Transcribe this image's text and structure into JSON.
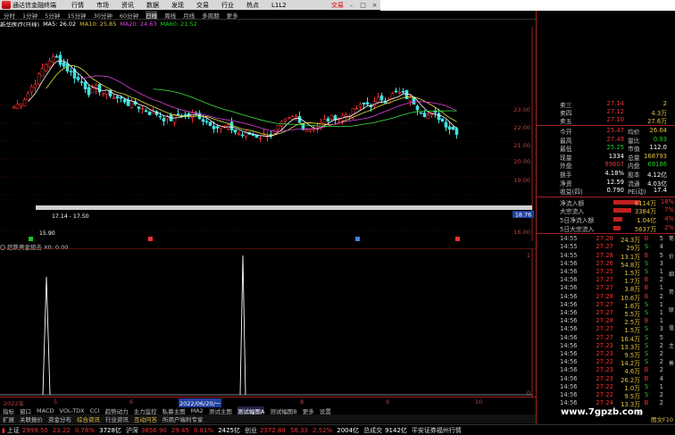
{
  "titlebar": {
    "app_name": "通达信金融终端",
    "menus": [
      "行情",
      "市场",
      "资讯",
      "数据",
      "发现",
      "交易",
      "行业",
      "热点",
      "L1L2"
    ],
    "trade_label": "交易"
  },
  "periods": [
    "分时",
    "1分钟",
    "5分钟",
    "15分钟",
    "30分钟",
    "60分钟",
    "日线",
    "周线",
    "月线",
    "多周期",
    "更多"
  ],
  "active_period": "日线",
  "ma_line": {
    "stock": "新华医疗(日线)",
    "ma5": "MA5: 26.02",
    "ma10": "MA10: 25.85",
    "ma20": "MA20: 24.63",
    "ma60": "MA60: 21.52"
  },
  "colors": {
    "up": "#f03030",
    "down": "#40e0e0",
    "ma5": "#ffffff",
    "ma10": "#e0e040",
    "ma20": "#e040e0",
    "ma60": "#40e040"
  },
  "main_chart": {
    "price_ticks": [
      "23.00",
      "22.00",
      "21.00",
      "20.00",
      "19.00",
      "17.00",
      "16.00"
    ],
    "current_price_tag": "18.76",
    "low_label": "15.90",
    "range_label": "17.14 - 17.50"
  },
  "sub_chart": {
    "title": "超跌黄金狙击 X0: 0.00",
    "ticks": [
      "1",
      "0"
    ]
  },
  "date_axis": {
    "labels": [
      "2022年",
      "5",
      "6",
      "2022/06/20/一",
      "8",
      "9",
      "10"
    ]
  },
  "indicator_tabs": [
    "指标",
    "窗口",
    "MACD",
    "VOL-TDX",
    "CCI",
    "趋势动力",
    "主力监控",
    "私募主图",
    "MA2",
    "测试主图",
    "测试幅图A",
    "测试幅图B",
    "更多",
    "设置"
  ],
  "active_indicator": "测试幅图A",
  "ext_tabs": [
    "扩展",
    "关联报价",
    "资金分布",
    "综合资讯",
    "行业资讯",
    "互动问答",
    "所用户端利专家"
  ],
  "status": {
    "sh_label": "上证",
    "sh_value": "2999.50",
    "sh_chg": "23.22",
    "sh_pct": "0.78%",
    "sh_amount": "3728亿",
    "sz_label": "沪深",
    "sz_value": "3656.90",
    "sz_chg": "29.45",
    "sz_pct": "0.81%",
    "sz_amount": "2425亿",
    "cy_label": "创业",
    "cy_value": "2372.88",
    "cy_chg": "58.33",
    "cy_pct": "2.52%",
    "cy_amount": "2004亿",
    "total_label": "总成交",
    "total_value": "9142亿",
    "broker": "平安证券福州行情"
  },
  "quote": {
    "sells": [
      {
        "label": "卖三",
        "price": "27.14",
        "vol": "2"
      },
      {
        "label": "卖四",
        "price": "27.12",
        "vol": "4.3万"
      },
      {
        "label": "卖五",
        "price": "27.10",
        "vol": "27.6万"
      }
    ],
    "rows": [
      {
        "k": "今开",
        "v": "25.47",
        "k2": "均价",
        "v2": "26.64"
      },
      {
        "k": "最高",
        "v": "27.49",
        "k2": "量比",
        "v2": "0.93"
      },
      {
        "k": "最低",
        "v": "25.25",
        "k2": "市值",
        "v2": "112.0"
      },
      {
        "k": "现量",
        "v": "1334",
        "k2": "总量",
        "v2": "168793"
      },
      {
        "k": "外盘",
        "v": "99607",
        "k2": "内盘",
        "v2": "69186"
      },
      {
        "k": "换手",
        "v": "4.18%",
        "k2": "股本",
        "v2": "4.12亿"
      },
      {
        "k": "净资",
        "v": "12.59",
        "k2": "流通",
        "v2": "4.03亿"
      },
      {
        "k": "收益(四)",
        "v": "0.790",
        "k2": "PE(动)",
        "v2": "17.4"
      }
    ],
    "flows": [
      {
        "k": "净流入额",
        "v": "6114万",
        "p": "18%"
      },
      {
        "k": "大宗流入",
        "v": "3384万",
        "p": "7%"
      },
      {
        "k": "5日净流入额",
        "v": "1.04亿",
        "p": "4%"
      },
      {
        "k": "5日大宗流入",
        "v": "5637万",
        "p": "2%"
      }
    ],
    "ticks": [
      {
        "t": "14:55",
        "p": "27.28",
        "q": "24.3万",
        "s": "B",
        "n": "5"
      },
      {
        "t": "14:55",
        "p": "27.27",
        "q": "29万",
        "s": "S",
        "n": "4"
      },
      {
        "t": "14:55",
        "p": "27.28",
        "q": "13.1万",
        "s": "B",
        "n": "5"
      },
      {
        "t": "14:56",
        "p": "27.26",
        "q": "54.8万",
        "s": "S",
        "n": "3"
      },
      {
        "t": "14:56",
        "p": "27.25",
        "q": "1.5万",
        "s": "S",
        "n": "1"
      },
      {
        "t": "14:56",
        "p": "27.27",
        "q": "1.7万",
        "s": "B",
        "n": "2"
      },
      {
        "t": "14:56",
        "p": "27.27",
        "q": "3.8万",
        "s": "B",
        "n": "1"
      },
      {
        "t": "14:56",
        "p": "27.28",
        "q": "10.6万",
        "s": "B",
        "n": "2"
      },
      {
        "t": "14:56",
        "p": "27.27",
        "q": "1.6万",
        "s": "S",
        "n": "1"
      },
      {
        "t": "14:56",
        "p": "27.27",
        "q": "5.5万",
        "s": "S",
        "n": "1"
      },
      {
        "t": "14:56",
        "p": "27.28",
        "q": "2.5万",
        "s": "B",
        "n": "1"
      },
      {
        "t": "14:56",
        "p": "27.27",
        "q": "1.5万",
        "s": "S",
        "n": "3"
      },
      {
        "t": "14:56",
        "p": "27.27",
        "q": "16.4万",
        "s": "S",
        "n": "5"
      },
      {
        "t": "14:56",
        "p": "27.23",
        "q": "13.3万",
        "s": "S",
        "n": "2"
      },
      {
        "t": "14:56",
        "p": "27.23",
        "q": "9.5万",
        "s": "S",
        "n": "2"
      },
      {
        "t": "14:56",
        "p": "27.22",
        "q": "14.2万",
        "s": "S",
        "n": "2"
      },
      {
        "t": "14:56",
        "p": "27.23",
        "q": "4.6万",
        "s": "B",
        "n": "2"
      },
      {
        "t": "14:56",
        "p": "27.23",
        "q": "26.2万",
        "s": "B",
        "n": "4"
      },
      {
        "t": "14:56",
        "p": "27.22",
        "q": "1.0万",
        "s": "S",
        "n": "1"
      },
      {
        "t": "14:56",
        "p": "27.22",
        "q": "9.5万",
        "s": "S",
        "n": "2"
      },
      {
        "t": "14:56",
        "p": "27.24",
        "q": "13.3万",
        "s": "B",
        "n": "2"
      }
    ],
    "bottom_label": "细",
    "bottom_label2": "图文F10",
    "side_buttons": [
      "笔",
      "价",
      "细",
      "势",
      "联",
      "值",
      "主",
      "筹"
    ]
  },
  "watermark": "www.7gpzb.com"
}
